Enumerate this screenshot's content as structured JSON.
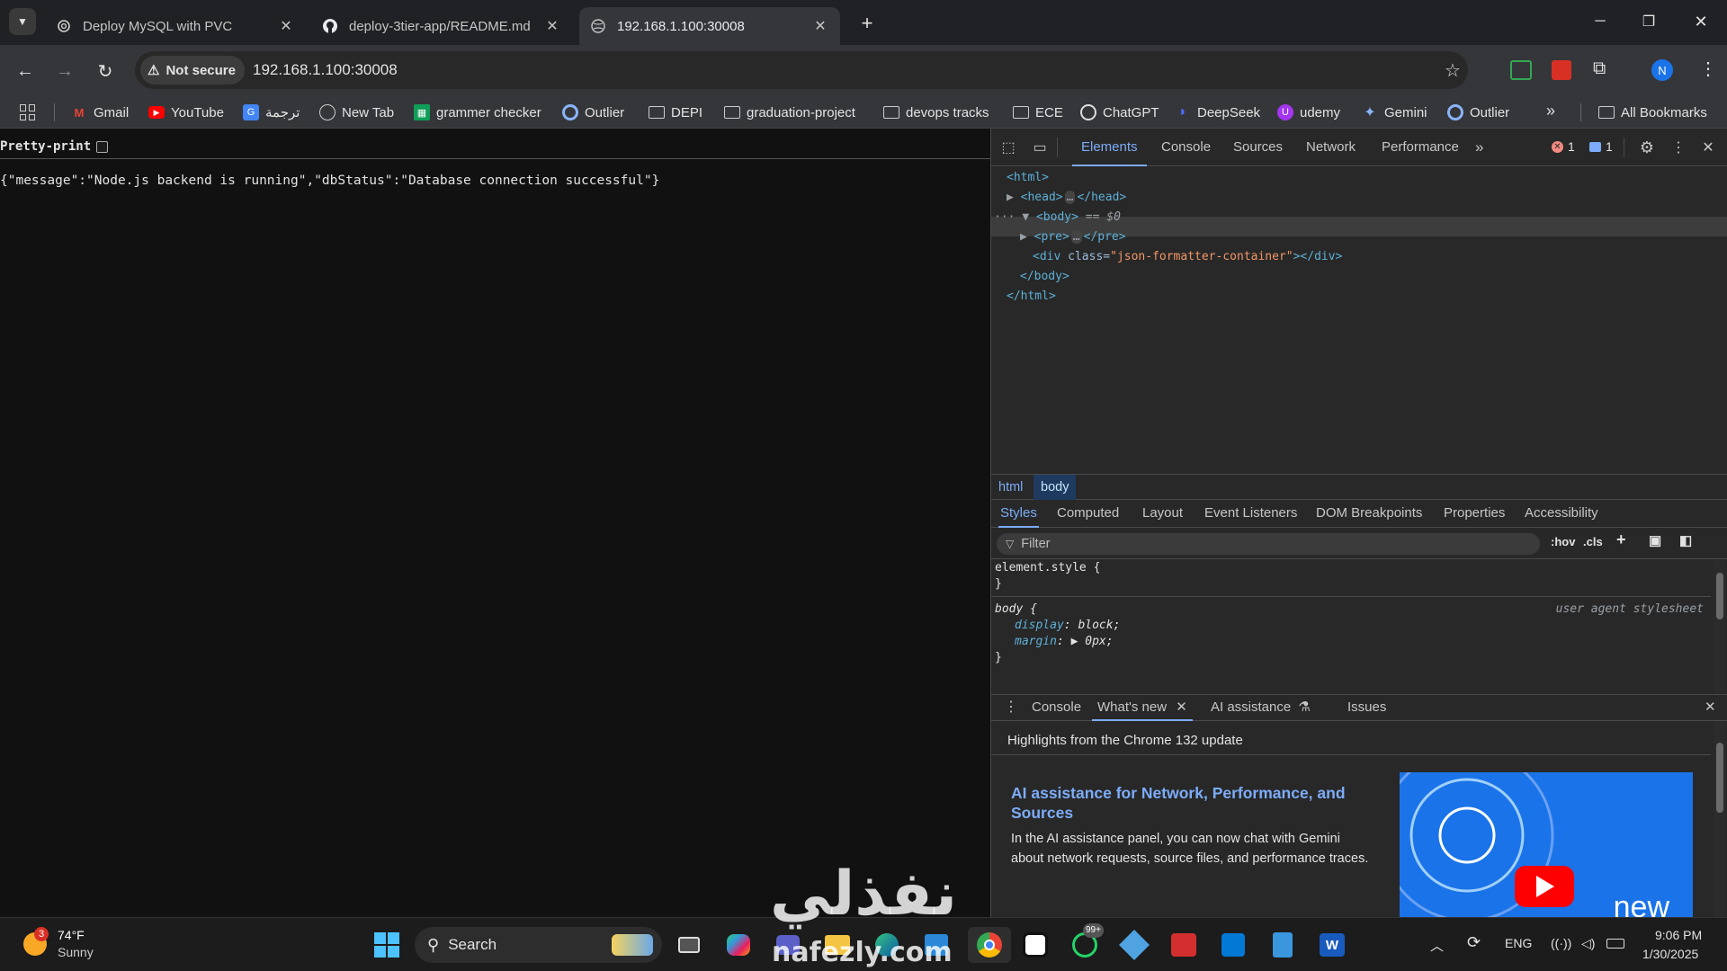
{
  "tabs": [
    {
      "title": "Deploy MySQL with PVC",
      "icon": "chatgpt-icon",
      "active": false
    },
    {
      "title": "deploy-3tier-app/README.md",
      "icon": "github-icon",
      "active": false
    },
    {
      "title": "192.168.1.100:30008",
      "icon": "globe-icon",
      "active": true
    }
  ],
  "toolbar": {
    "security_label": "Not secure",
    "url": "192.168.1.100:30008",
    "profile_initial": "N"
  },
  "bookmarks": [
    {
      "label": "Gmail",
      "icon": "gmail-icon"
    },
    {
      "label": "YouTube",
      "icon": "youtube-icon"
    },
    {
      "label": "ترجمة",
      "icon": "translate-icon"
    },
    {
      "label": "New Tab",
      "icon": "globe-icon"
    },
    {
      "label": "grammer checker",
      "icon": "sheet-icon"
    },
    {
      "label": "Outlier",
      "icon": "outlier-icon"
    },
    {
      "label": "DEPI",
      "icon": "folder-icon"
    },
    {
      "label": "graduation-project",
      "icon": "folder-icon"
    },
    {
      "label": "devops tracks",
      "icon": "folder-icon"
    },
    {
      "label": "ECE",
      "icon": "folder-icon"
    },
    {
      "label": "ChatGPT",
      "icon": "chatgpt-icon"
    },
    {
      "label": "DeepSeek",
      "icon": "deepseek-icon"
    },
    {
      "label": "udemy",
      "icon": "udemy-icon"
    },
    {
      "label": "Gemini",
      "icon": "gemini-icon"
    },
    {
      "label": "Outlier",
      "icon": "outlier-icon"
    }
  ],
  "all_bookmarks_label": "All Bookmarks",
  "page": {
    "pretty_print_label": "Pretty-print",
    "pretty_print_checked": false,
    "json_text": "{\"message\":\"Node.js backend is running\",\"dbStatus\":\"Database connection successful\"}"
  },
  "devtools": {
    "tabs": [
      "Elements",
      "Console",
      "Sources",
      "Network",
      "Performance"
    ],
    "selected_tab": "Elements",
    "error_count": "1",
    "message_count": "1",
    "dom": {
      "html_open": "<html>",
      "head_open": "<head>",
      "head_close": "</head>",
      "body_open": "<body>",
      "body_marker": "== $0",
      "pre_open": "<pre>",
      "pre_close": "</pre>",
      "div_tag": "<div",
      "div_attr_name": "class=",
      "div_attr_value": "\"json-formatter-container\"",
      "div_close": "></div>",
      "body_close": "</body>",
      "html_close": "</html>",
      "ellipsis": "…"
    },
    "breadcrumbs": [
      "html",
      "body"
    ],
    "subtabs": [
      "Styles",
      "Computed",
      "Layout",
      "Event Listeners",
      "DOM Breakpoints",
      "Properties",
      "Accessibility"
    ],
    "filter_placeholder": "Filter",
    "hov_label": ":hov",
    "cls_label": ".cls",
    "styles": {
      "element_style": "element.style {",
      "close_brace": "}",
      "body_selector": "body {",
      "user_agent": "user agent stylesheet",
      "rules": [
        {
          "prop": "display",
          "value": "block;"
        },
        {
          "prop": "margin",
          "value": "0px;"
        }
      ]
    },
    "drawer": {
      "tabs": [
        "Console",
        "What's new",
        "AI assistance",
        "Issues"
      ],
      "selected_tab": "What's new",
      "highlights": "Highlights from the Chrome 132 update",
      "feature_title": "AI assistance for Network, Performance, and Sources",
      "feature_body": "In the AI assistance panel, you can now chat with Gemini about network requests, source files, and performance traces.",
      "feature_image_text": "new"
    }
  },
  "taskbar": {
    "weather_temp": "74°F",
    "weather_desc": "Sunny",
    "weather_badge": "3",
    "search_label": "Search",
    "whatsapp_badge": "99+",
    "language": "ENG",
    "time": "9:06 PM",
    "date": "1/30/2025"
  },
  "watermark": {
    "arabic": "نفذلي",
    "latin": "nafezly.com"
  },
  "colors": {
    "accent": "#7cacf8",
    "tag": "#5db0d7",
    "attr_value": "#f29766",
    "error": "#f28b82"
  }
}
